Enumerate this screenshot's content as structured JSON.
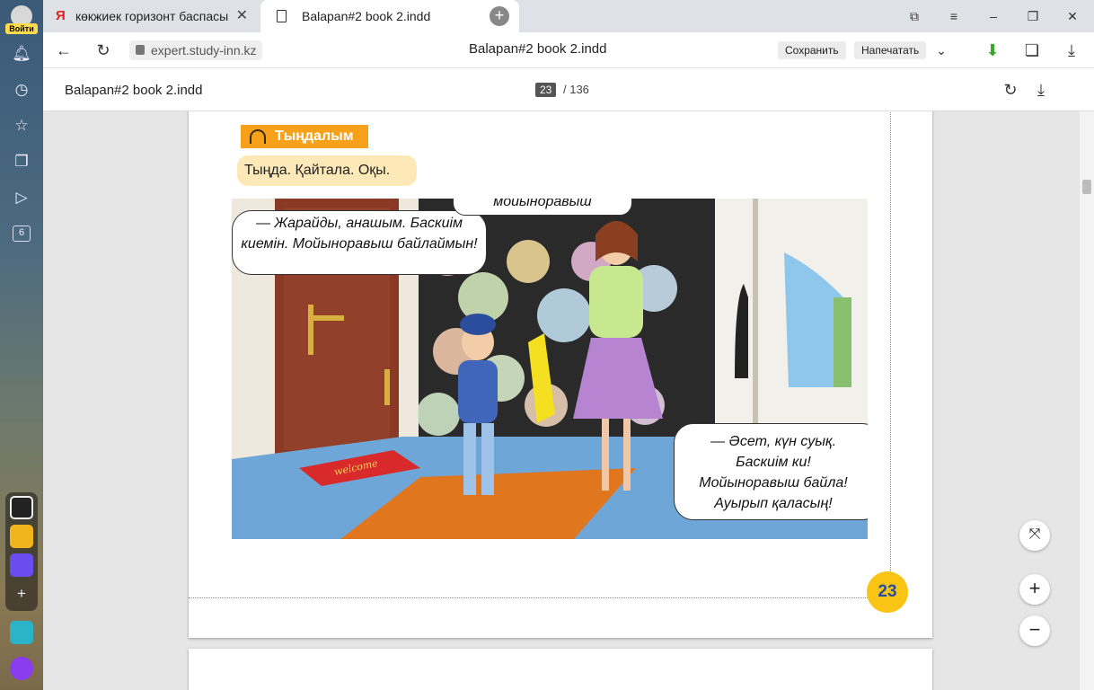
{
  "sidebar": {
    "login_label": "Войти",
    "badge": "6"
  },
  "tabs": [
    {
      "label": "көкжиек горизонт баспасы",
      "active": false
    },
    {
      "label": "Balapan#2 book 2.indd",
      "active": true
    }
  ],
  "address_bar": {
    "url": "expert.study-inn.kz",
    "title": "Balapan#2 book 2.indd",
    "save_label": "Сохранить",
    "print_label": "Напечатать"
  },
  "pdf_toolbar": {
    "title": "Balapan#2 book 2.indd",
    "current_page": "23",
    "total_pages": "/ 136"
  },
  "page": {
    "heading": "Тыңдалым",
    "instruction": "Тыңда. Қайтала. Оқы.",
    "bubble_top": "мойыноравыш",
    "bubble_left": "— Жарайды, анашым. Баскиім киемін. Мойыноравыш байлаймын!",
    "bubble_right": "— Әсет, күн суық. Баскиім ки! Мойыноравыш байла! Ауырып қаласың!",
    "mat_text": "welcome",
    "page_number": "23"
  },
  "colors": {
    "heading_bg": "#f7a11a",
    "instruction_bg": "#fde9b8",
    "page_badge": "#f9c413",
    "page_number_text": "#2a4fa0"
  }
}
